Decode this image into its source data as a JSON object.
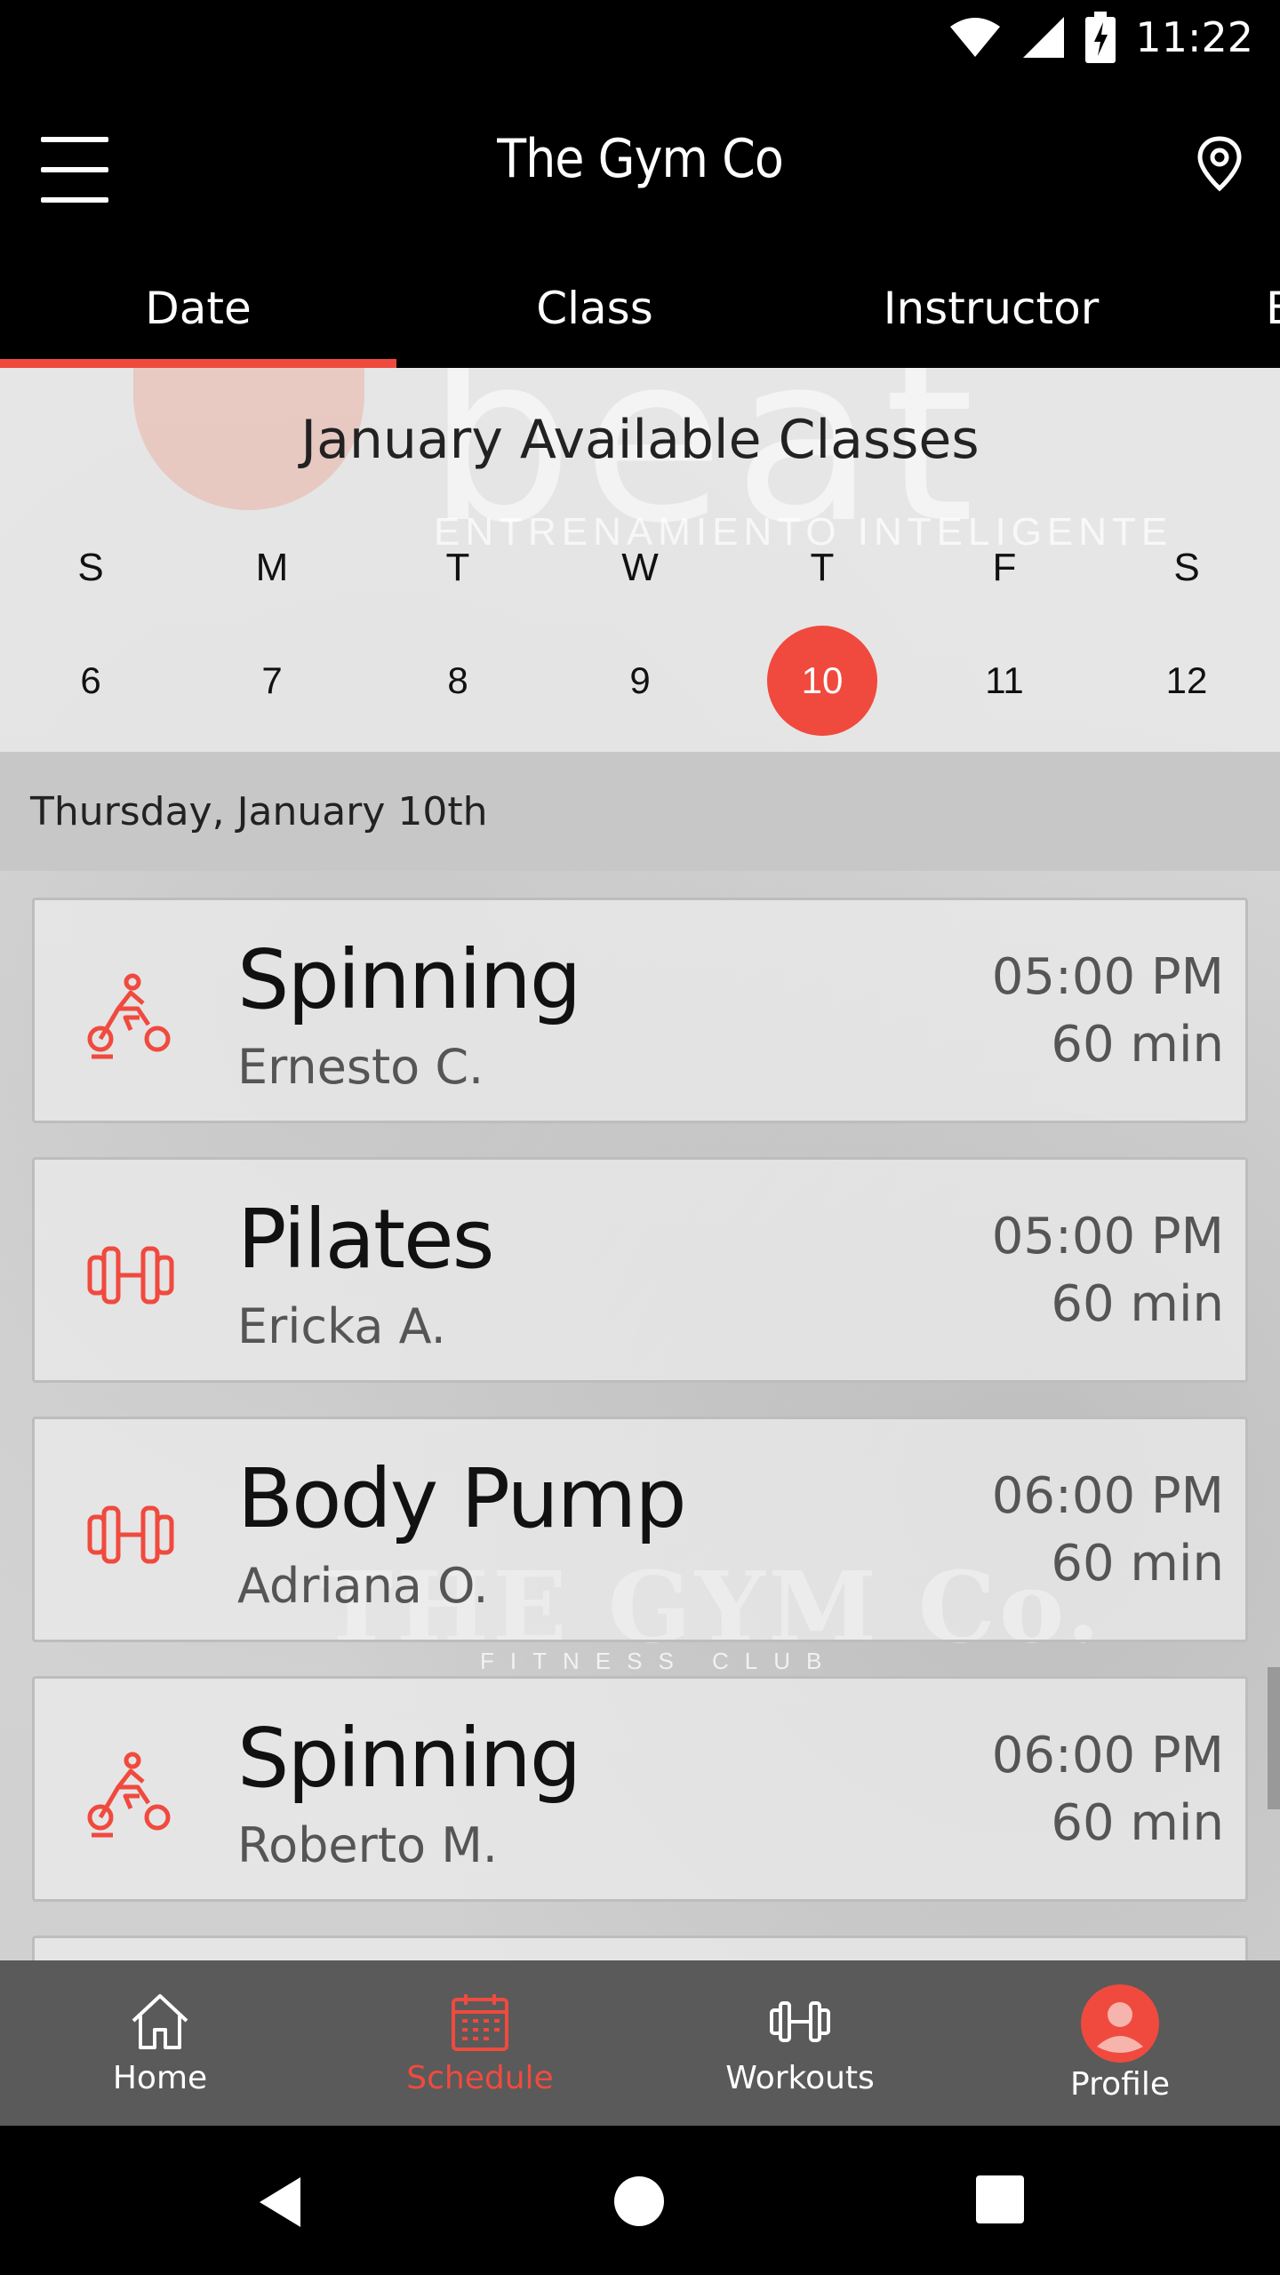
{
  "status_bar": {
    "time": "11:22"
  },
  "app_bar": {
    "title": "The Gym Co"
  },
  "tabs": [
    {
      "label": "Date",
      "active": true
    },
    {
      "label": "Class",
      "active": false
    },
    {
      "label": "Instructor",
      "active": false
    },
    {
      "label": "B",
      "active": false
    }
  ],
  "calendar": {
    "title": "January Available Classes",
    "weekdays": [
      "S",
      "M",
      "T",
      "W",
      "T",
      "F",
      "S"
    ],
    "days": [
      "6",
      "7",
      "8",
      "9",
      "10",
      "11",
      "12"
    ],
    "selected_day": "10"
  },
  "background_text": {
    "brand_large": "beat",
    "brand_tagline": "ENTRENAMIENTO INTELIGENTE",
    "gym_logo": "THE GYM Co.",
    "gym_logo_sub": "FITNESS CLUB"
  },
  "date_header": "Thursday, January 10th",
  "classes": [
    {
      "name": "Spinning",
      "instructor": "Ernesto C.",
      "time": "05:00 PM",
      "duration": "60 min",
      "icon": "bike-icon"
    },
    {
      "name": "Pilates",
      "instructor": "Ericka A.",
      "time": "05:00 PM",
      "duration": "60 min",
      "icon": "dumbbell-icon"
    },
    {
      "name": "Body Pump",
      "instructor": "Adriana O.",
      "time": "06:00 PM",
      "duration": "60 min",
      "icon": "dumbbell-icon"
    },
    {
      "name": "Spinning",
      "instructor": "Roberto M.",
      "time": "06:00 PM",
      "duration": "60 min",
      "icon": "bike-icon"
    }
  ],
  "bottom_nav": [
    {
      "label": "Home",
      "icon": "home-icon",
      "active": false
    },
    {
      "label": "Schedule",
      "icon": "calendar-icon",
      "active": true
    },
    {
      "label": "Workouts",
      "icon": "dumbbell-icon",
      "active": false
    },
    {
      "label": "Profile",
      "icon": "avatar-icon",
      "active": false
    }
  ],
  "colors": {
    "accent": "#f04a3e",
    "nav_bg": "#5a5a5a"
  }
}
